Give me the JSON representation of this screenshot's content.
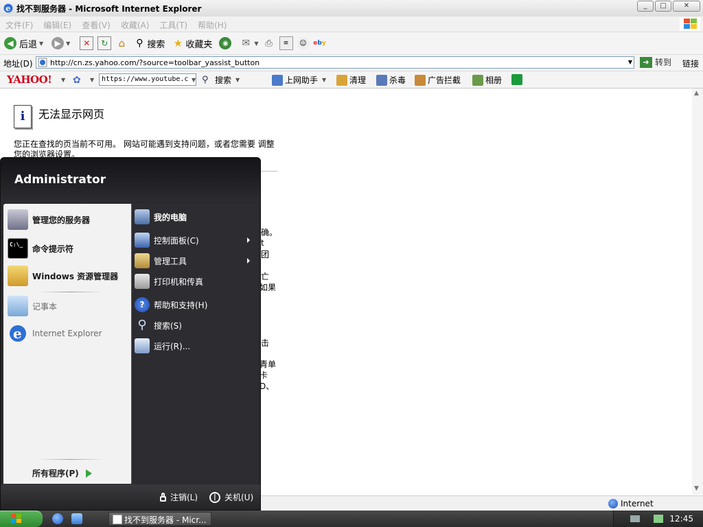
{
  "window": {
    "title": "找不到服务器 - Microsoft Internet Explorer",
    "controls": {
      "minimize": "_",
      "maximize": "□",
      "close": "✕"
    }
  },
  "menu": [
    "文件(F)",
    "编辑(E)",
    "查看(V)",
    "收藏(A)",
    "工具(T)",
    "帮助(H)"
  ],
  "toolbar": {
    "back": "后退",
    "search": "搜索",
    "favorites": "收藏夹"
  },
  "address": {
    "label": "地址(D)",
    "url": "http://cn.zs.yahoo.com/?source=toolbar_yassist_button",
    "go": "转到",
    "links": "链接"
  },
  "yahoo_bar": {
    "logo": "YAHOO!",
    "search_box": "https://www.youtube.c",
    "search": "搜索",
    "helper": "上网助手",
    "clean": "清理",
    "antivirus": "杀毒",
    "adblock": "广告拦截",
    "album": "相册"
  },
  "page": {
    "title": "无法显示网页",
    "line1": "您正在查找的页当前不可用。 网站可能遇到支持问题，或者您需要 调整",
    "line2": "您的浏览器设置。",
    "frag_1": "确。",
    "frag_2": "t",
    "frag_3": "团",
    "frag_4": "亡",
    "frag_5": "如果",
    "frag_6": "击",
    "frag_7": "青单",
    "frag_8": "卡",
    "frag_9": "D、"
  },
  "status": {
    "zone": "Internet"
  },
  "start_menu": {
    "user": "Administrator",
    "left": [
      {
        "label": "管理您的服务器"
      },
      {
        "label": "命令提示符"
      },
      {
        "label": "Windows 资源管理器"
      },
      {
        "label": "记事本"
      },
      {
        "label": "Internet Explorer"
      }
    ],
    "all_programs": "所有程序(P)",
    "right": [
      {
        "label": "我的电脑"
      },
      {
        "label": "控制面板(C)"
      },
      {
        "label": "管理工具"
      },
      {
        "label": "打印机和传真"
      },
      {
        "label": "帮助和支持(H)"
      },
      {
        "label": "搜索(S)"
      },
      {
        "label": "运行(R)..."
      }
    ],
    "logoff": "注销(L)",
    "shutdown": "关机(U)"
  },
  "taskbar": {
    "task": "找不到服务器 - Micr...",
    "clock": "12:45"
  },
  "colors": {
    "start_green": "#3a9a3a",
    "menu_dark": "#2a2a2e",
    "yahoo_red": "#d0021b"
  }
}
